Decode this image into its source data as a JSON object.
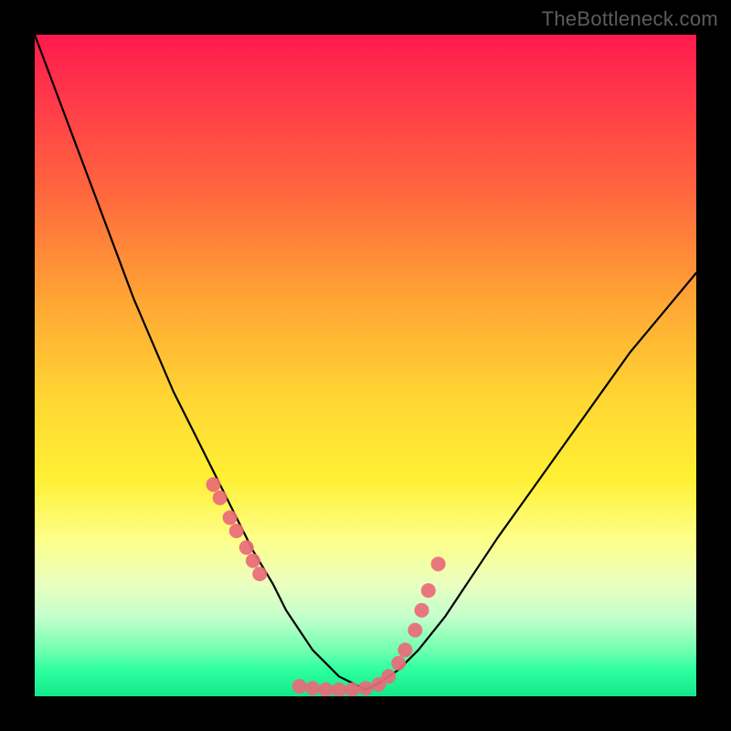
{
  "watermark": "TheBottleneck.com",
  "chart_data": {
    "type": "line",
    "title": "",
    "xlabel": "",
    "ylabel": "",
    "xlim": [
      0,
      100
    ],
    "ylim": [
      0,
      100
    ],
    "grid": false,
    "series": [
      {
        "name": "bottleneck-curve",
        "x": [
          0,
          3,
          6,
          9,
          12,
          15,
          18,
          21,
          24,
          27,
          30,
          33,
          36,
          38,
          40,
          42,
          44,
          46,
          48,
          50,
          52,
          55,
          58,
          62,
          66,
          70,
          75,
          80,
          85,
          90,
          95,
          100
        ],
        "y": [
          100,
          92,
          84,
          76,
          68,
          60,
          53,
          46,
          40,
          34,
          28,
          22,
          17,
          13,
          10,
          7,
          5,
          3,
          2,
          1,
          2,
          4,
          7,
          12,
          18,
          24,
          31,
          38,
          45,
          52,
          58,
          64
        ]
      }
    ],
    "markers": {
      "name": "data-points",
      "color": "#e96a7a",
      "x": [
        27,
        28,
        29.5,
        30.5,
        32,
        33,
        34,
        40,
        42,
        44,
        46,
        48,
        50,
        52,
        53.5,
        55,
        56,
        57.5,
        58.5,
        59.5,
        61
      ],
      "y": [
        32,
        30,
        27,
        25,
        22.5,
        20.5,
        18.5,
        1.5,
        1.2,
        1,
        1,
        1,
        1.2,
        1.8,
        3,
        5,
        7,
        10,
        13,
        16,
        20
      ]
    }
  }
}
